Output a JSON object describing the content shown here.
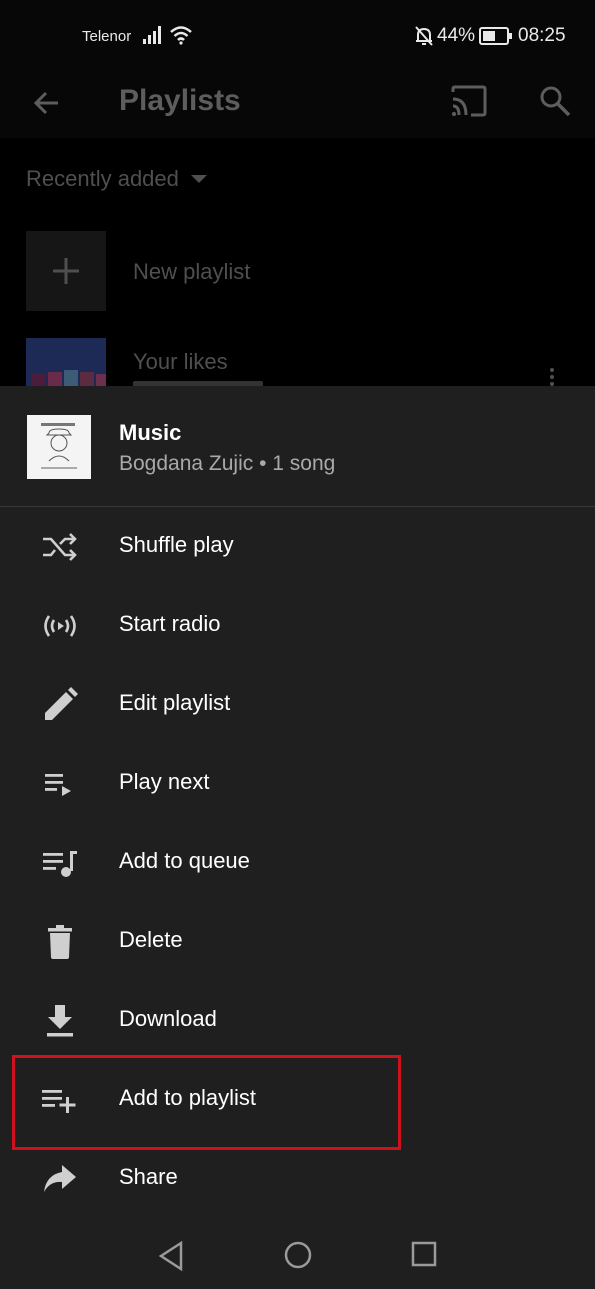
{
  "status_bar": {
    "carrier": "Telenor",
    "battery_percent": "44%",
    "time": "08:25"
  },
  "app_bar": {
    "title": "Playlists"
  },
  "background_list": {
    "sort_label": "Recently added",
    "new_playlist_label": "New playlist",
    "likes_label": "Your likes"
  },
  "sheet": {
    "title": "Music",
    "subtitle": "Bogdana Zujic • 1 song",
    "items": [
      {
        "label": "Shuffle play",
        "icon": "shuffle-icon"
      },
      {
        "label": "Start radio",
        "icon": "radio-icon"
      },
      {
        "label": "Edit playlist",
        "icon": "pencil-icon"
      },
      {
        "label": "Play next",
        "icon": "play-next-icon"
      },
      {
        "label": "Add to queue",
        "icon": "queue-icon"
      },
      {
        "label": "Delete",
        "icon": "trash-icon"
      },
      {
        "label": "Download",
        "icon": "download-icon"
      },
      {
        "label": "Add to playlist",
        "icon": "playlist-add-icon"
      },
      {
        "label": "Share",
        "icon": "share-icon"
      }
    ]
  },
  "colors": {
    "sheet_background": "#1f1f1f",
    "highlight_border": "#d0101d"
  }
}
